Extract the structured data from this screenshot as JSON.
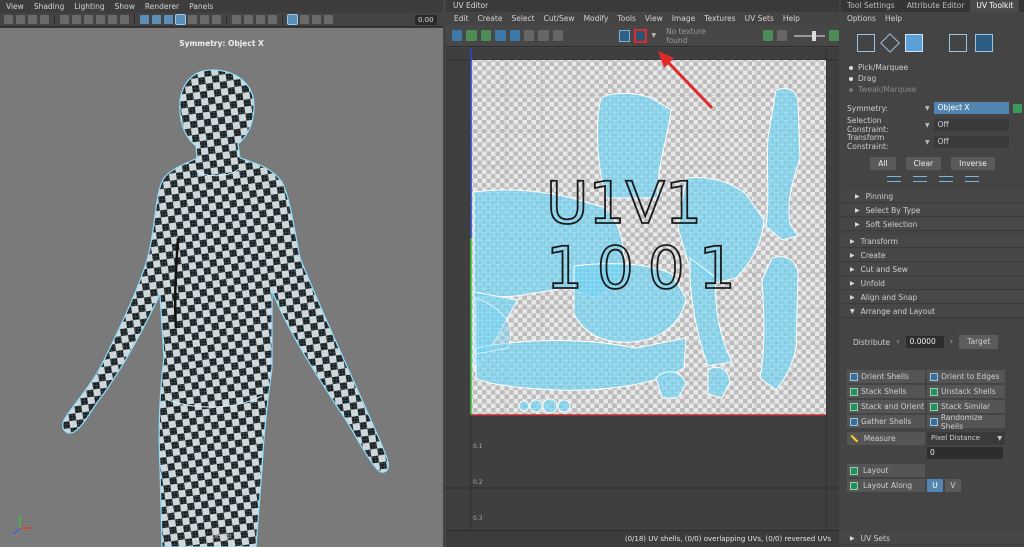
{
  "viewport": {
    "menu": [
      "View",
      "Shading",
      "Lighting",
      "Show",
      "Renderer",
      "Panels"
    ],
    "field_value": "0.00",
    "symmetry_label": "Symmetry: Object X",
    "camera_label": "persp"
  },
  "uv_editor": {
    "title": "UV Editor",
    "menu": [
      "Edit",
      "Create",
      "Select",
      "Cut/Sew",
      "Modify",
      "Tools",
      "View",
      "Image",
      "Textures",
      "UV Sets",
      "Help"
    ],
    "texture_placeholder": "No texture found",
    "tile_label_1": "U1V1",
    "tile_label_2": "1001",
    "axis_ticks": [
      "0.1",
      "0.2",
      "0.3"
    ],
    "status": "(0/18) UV shells, (0/0) overlapping UVs, (0/0) reversed UVs"
  },
  "toolkit": {
    "tabs": [
      "Tool Settings",
      "Attribute Editor",
      "UV Toolkit"
    ],
    "active_tab": "UV Toolkit",
    "menu": [
      "Options",
      "Help"
    ],
    "select_modes": [
      "Pick/Marquee",
      "Drag",
      "Tweak/Marquee"
    ],
    "symmetry": {
      "label": "Symmetry:",
      "value": "Object X"
    },
    "selection_constraint": {
      "label": "Selection Constraint:",
      "value": "Off"
    },
    "transform_constraint": {
      "label": "Transform Constraint:",
      "value": "Off"
    },
    "buttons": {
      "all": "All",
      "clear": "Clear",
      "inverse": "Inverse"
    },
    "sub_sections": [
      "Pinning",
      "Select By Type",
      "Soft Selection"
    ],
    "sections": [
      "Transform",
      "Create",
      "Cut and Sew",
      "Unfold",
      "Align and Snap",
      "Arrange and Layout"
    ],
    "distribute": {
      "label": "Distribute",
      "value": "0.0000",
      "target": "Target"
    },
    "layout_buttons": [
      "Orient Shells",
      "Orient to Edges",
      "Stack Shells",
      "Unstack Shells",
      "Stack and Orient",
      "Stack Similar",
      "Gather Shells",
      "Randomize Shells"
    ],
    "measure": {
      "label": "Measure",
      "mode": "Pixel Distance",
      "value": "0"
    },
    "layout": "Layout",
    "layout_along": {
      "label": "Layout Along",
      "u": "U",
      "v": "V"
    },
    "uv_sets": "UV Sets"
  },
  "colors": {
    "uv_shell": "#6fd0f0",
    "highlight": "#e02a2a",
    "accent": "#5285af"
  }
}
